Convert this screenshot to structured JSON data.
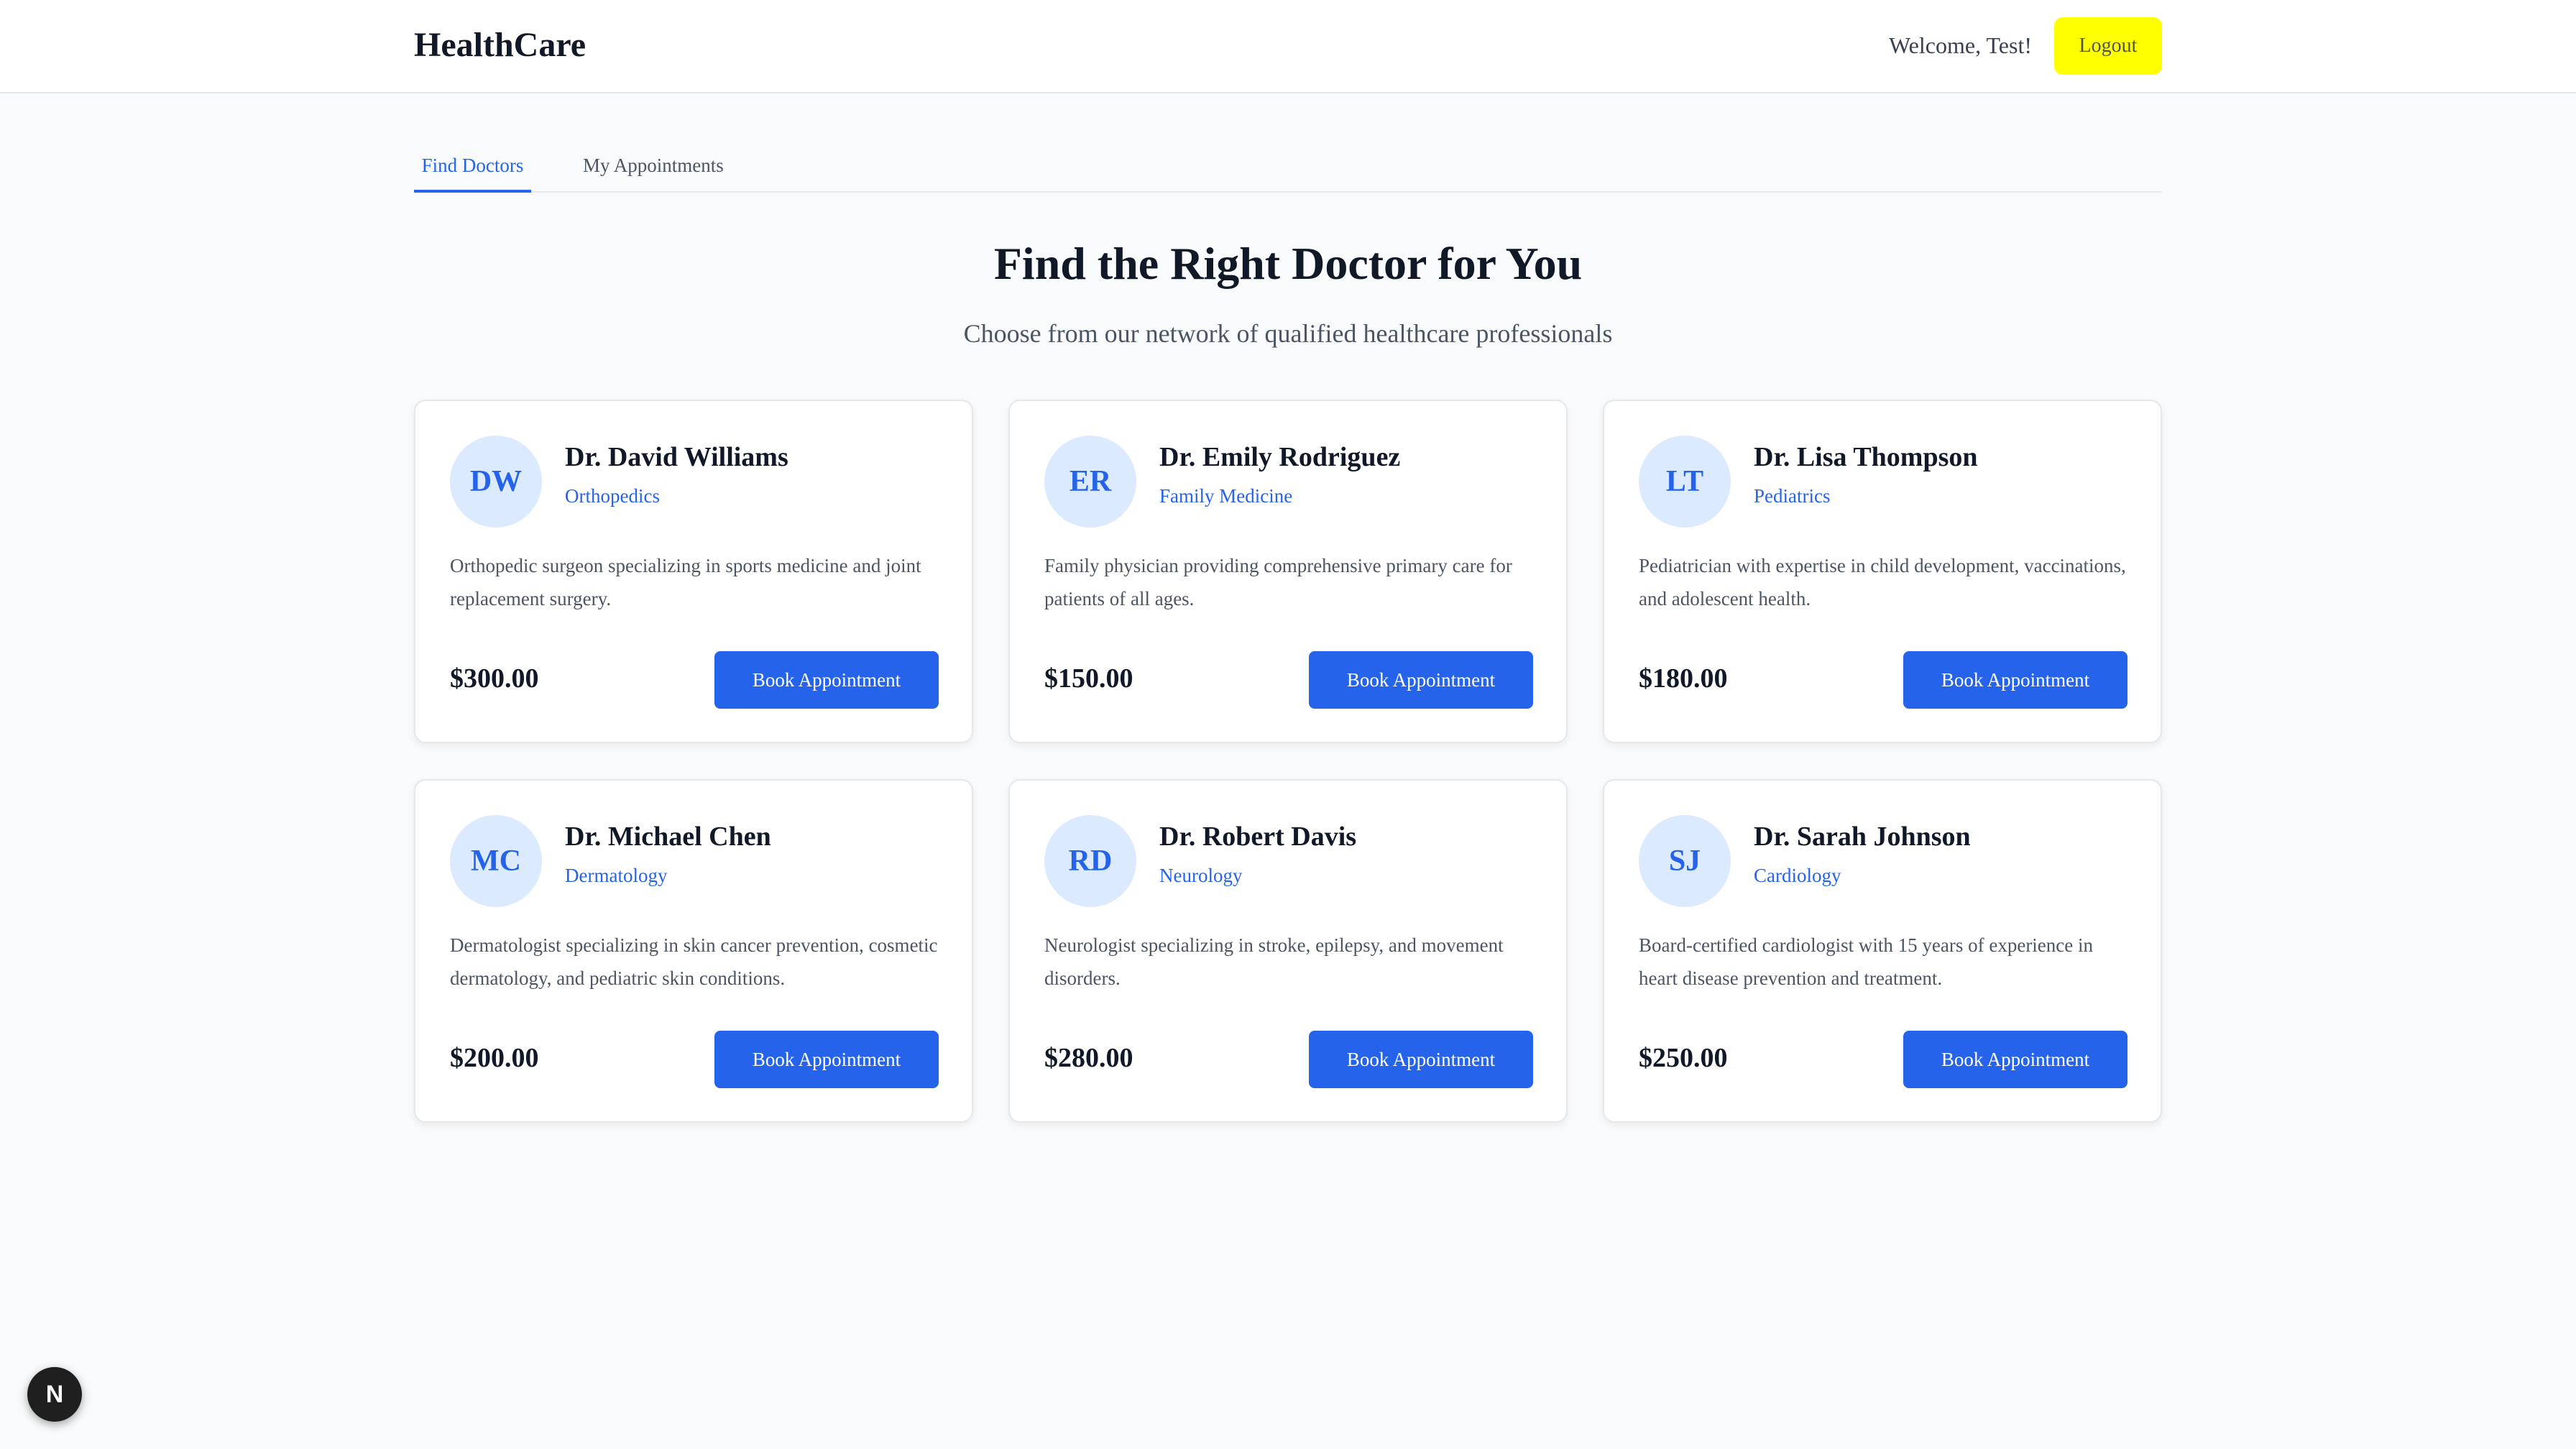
{
  "header": {
    "brand": "HealthCare",
    "welcome": "Welcome, Test!",
    "logout_label": "Logout",
    "logout_color": "#ffff00"
  },
  "tabs": [
    {
      "label": "Find Doctors",
      "active": true
    },
    {
      "label": "My Appointments",
      "active": false
    }
  ],
  "hero": {
    "title": "Find the Right Doctor for You",
    "subtitle": "Choose from our network of qualified healthcare professionals"
  },
  "accent_color": "#2563eb",
  "doctors": [
    {
      "initials": "DW",
      "name": "Dr. David Williams",
      "specialty": "Orthopedics",
      "description": "Orthopedic surgeon specializing in sports medicine and joint replacement surgery.",
      "price": "$300.00",
      "button": "Book Appointment"
    },
    {
      "initials": "ER",
      "name": "Dr. Emily Rodriguez",
      "specialty": "Family Medicine",
      "description": "Family physician providing comprehensive primary care for patients of all ages.",
      "price": "$150.00",
      "button": "Book Appointment"
    },
    {
      "initials": "LT",
      "name": "Dr. Lisa Thompson",
      "specialty": "Pediatrics",
      "description": "Pediatrician with expertise in child development, vaccinations, and adolescent health.",
      "price": "$180.00",
      "button": "Book Appointment"
    },
    {
      "initials": "MC",
      "name": "Dr. Michael Chen",
      "specialty": "Dermatology",
      "description": "Dermatologist specializing in skin cancer prevention, cosmetic dermatology, and pediatric skin conditions.",
      "price": "$200.00",
      "button": "Book Appointment"
    },
    {
      "initials": "RD",
      "name": "Dr. Robert Davis",
      "specialty": "Neurology",
      "description": "Neurologist specializing in stroke, epilepsy, and movement disorders.",
      "price": "$280.00",
      "button": "Book Appointment"
    },
    {
      "initials": "SJ",
      "name": "Dr. Sarah Johnson",
      "specialty": "Cardiology",
      "description": "Board-certified cardiologist with 15 years of experience in heart disease prevention and treatment.",
      "price": "$250.00",
      "button": "Book Appointment"
    }
  ],
  "dev_badge": {
    "label": "N",
    "icon": "nextjs-icon"
  }
}
